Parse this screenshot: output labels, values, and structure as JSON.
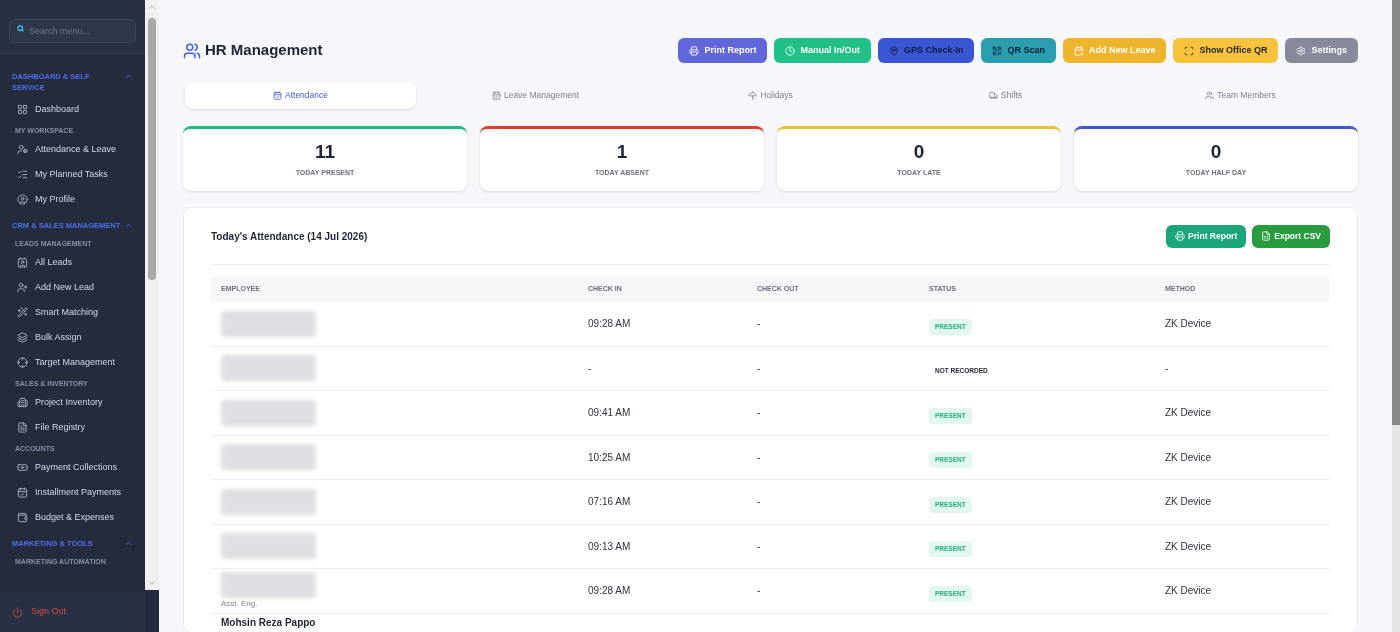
{
  "sidebar": {
    "search": {
      "placeholder": "Search menu..."
    },
    "items": [
      {
        "kind": "section",
        "label": "DASHBOARD & SELF SERVICE",
        "expanded": true
      },
      {
        "kind": "item",
        "label": "Dashboard"
      },
      {
        "kind": "subheading",
        "label": "MY WORKSPACE"
      },
      {
        "kind": "item",
        "label": "Attendance & Leave"
      },
      {
        "kind": "item",
        "label": "My Planned Tasks"
      },
      {
        "kind": "item",
        "label": "My Profile"
      },
      {
        "kind": "section",
        "label": "CRM & SALES MANAGEMENT",
        "expanded": true
      },
      {
        "kind": "subheading",
        "label": "LEADS MANAGEMENT"
      },
      {
        "kind": "item",
        "label": "All Leads"
      },
      {
        "kind": "item",
        "label": "Add New Lead"
      },
      {
        "kind": "item",
        "label": "Smart Matching"
      },
      {
        "kind": "item",
        "label": "Bulk Assign"
      },
      {
        "kind": "item",
        "label": "Target Management"
      },
      {
        "kind": "subheading",
        "label": "SALES & INVENTORY"
      },
      {
        "kind": "item",
        "label": "Project Inventory"
      },
      {
        "kind": "item",
        "label": "File Registry"
      },
      {
        "kind": "subheading",
        "label": "ACCOUNTS"
      },
      {
        "kind": "item",
        "label": "Payment Collections"
      },
      {
        "kind": "item",
        "label": "Installment Payments"
      },
      {
        "kind": "item",
        "label": "Budget & Expenses"
      },
      {
        "kind": "section",
        "label": "MARKETING & TOOLS",
        "expanded": true
      },
      {
        "kind": "subheading",
        "label": "MARKETING AUTOMATION"
      }
    ],
    "sign_out": "Sign Out"
  },
  "page": {
    "title": "HR Management",
    "actions": [
      {
        "label": "Print Report",
        "color": "#6068dc"
      },
      {
        "label": "Manual In/Out",
        "color": "#20c087"
      },
      {
        "label": "GPS Check-In",
        "color": "#3a56d4"
      },
      {
        "label": "QR Scan",
        "color": "#2a9eae"
      },
      {
        "label": "Add New Leave",
        "color": "#efb52c"
      },
      {
        "label": "Show Office QR",
        "color": "#f7c33d"
      },
      {
        "label": "Settings",
        "color": "#878a9a"
      }
    ],
    "tabs": [
      {
        "label": "Attendance",
        "selected": true
      },
      {
        "label": "Leave Management",
        "selected": false
      },
      {
        "label": "Holidays",
        "selected": false
      },
      {
        "label": "Shifts",
        "selected": false
      },
      {
        "label": "Team Members",
        "selected": false
      }
    ],
    "stats": [
      {
        "value": "11",
        "label": "TODAY PRESENT",
        "color": "#22b77c"
      },
      {
        "value": "1",
        "label": "TODAY ABSENT",
        "color": "#d9412f"
      },
      {
        "value": "0",
        "label": "TODAY LATE",
        "color": "#e8c33a"
      },
      {
        "value": "0",
        "label": "TODAY HALF DAY",
        "color": "#3f5bc9"
      }
    ],
    "attendance": {
      "title": "Today's Attendance (14 Jul 2026)",
      "buttons": [
        "Print Report",
        "Export CSV"
      ],
      "columns": [
        "EMPLOYEE",
        "CHECK IN",
        "CHECK OUT",
        "STATUS",
        "METHOD"
      ],
      "rows": [
        {
          "check_in": "09:28 AM",
          "check_out": "-",
          "status": {
            "kind": "present",
            "label": "PRESENT"
          },
          "method": "ZK Device"
        },
        {
          "check_in": "-",
          "check_out": "-",
          "status": {
            "kind": "not_recorded",
            "label": "NOT RECORDED"
          },
          "method": "-"
        },
        {
          "check_in": "09:41 AM",
          "check_out": "-",
          "status": {
            "kind": "present",
            "label": "PRESENT"
          },
          "method": "ZK Device"
        },
        {
          "check_in": "10:25 AM",
          "check_out": "-",
          "status": {
            "kind": "present",
            "label": "PRESENT"
          },
          "method": "ZK Device"
        },
        {
          "check_in": "07:16 AM",
          "check_out": "-",
          "status": {
            "kind": "present",
            "label": "PRESENT"
          },
          "method": "ZK Device"
        },
        {
          "check_in": "09:13 AM",
          "check_out": "-",
          "status": {
            "kind": "present",
            "label": "PRESENT"
          },
          "method": "ZK Device"
        },
        {
          "designation": "Asst. Eng.",
          "check_in": "09:28 AM",
          "check_out": "-",
          "status": {
            "kind": "present",
            "label": "PRESENT"
          },
          "method": "ZK Device"
        },
        {
          "name": "Mohsin Reza Pappo"
        }
      ]
    }
  }
}
